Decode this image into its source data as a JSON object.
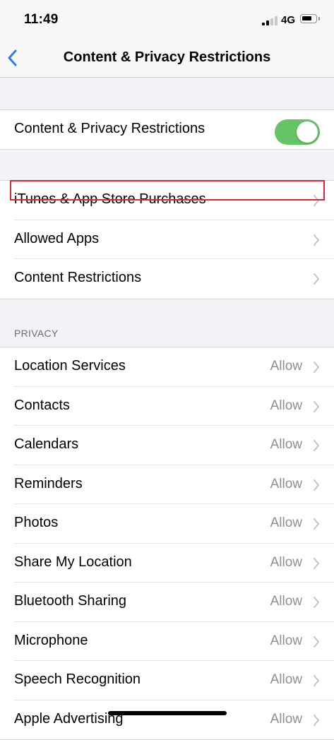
{
  "status_bar": {
    "time": "11:49",
    "network": "4G"
  },
  "nav": {
    "title": "Content & Privacy Restrictions"
  },
  "master": {
    "label": "Content & Privacy Restrictions",
    "enabled": true
  },
  "store_group": [
    {
      "label": "iTunes & App Store Purchases"
    },
    {
      "label": "Allowed Apps"
    },
    {
      "label": "Content Restrictions"
    }
  ],
  "privacy": {
    "header": "PRIVACY",
    "items": [
      {
        "label": "Location Services",
        "value": "Allow"
      },
      {
        "label": "Contacts",
        "value": "Allow"
      },
      {
        "label": "Calendars",
        "value": "Allow"
      },
      {
        "label": "Reminders",
        "value": "Allow"
      },
      {
        "label": "Photos",
        "value": "Allow"
      },
      {
        "label": "Share My Location",
        "value": "Allow"
      },
      {
        "label": "Bluetooth Sharing",
        "value": "Allow"
      },
      {
        "label": "Microphone",
        "value": "Allow"
      },
      {
        "label": "Speech Recognition",
        "value": "Allow"
      },
      {
        "label": "Apple Advertising",
        "value": "Allow"
      }
    ]
  },
  "colors": {
    "toggle_on": "#65c466",
    "highlight": "#d9283a",
    "accent": "#3478f6"
  }
}
